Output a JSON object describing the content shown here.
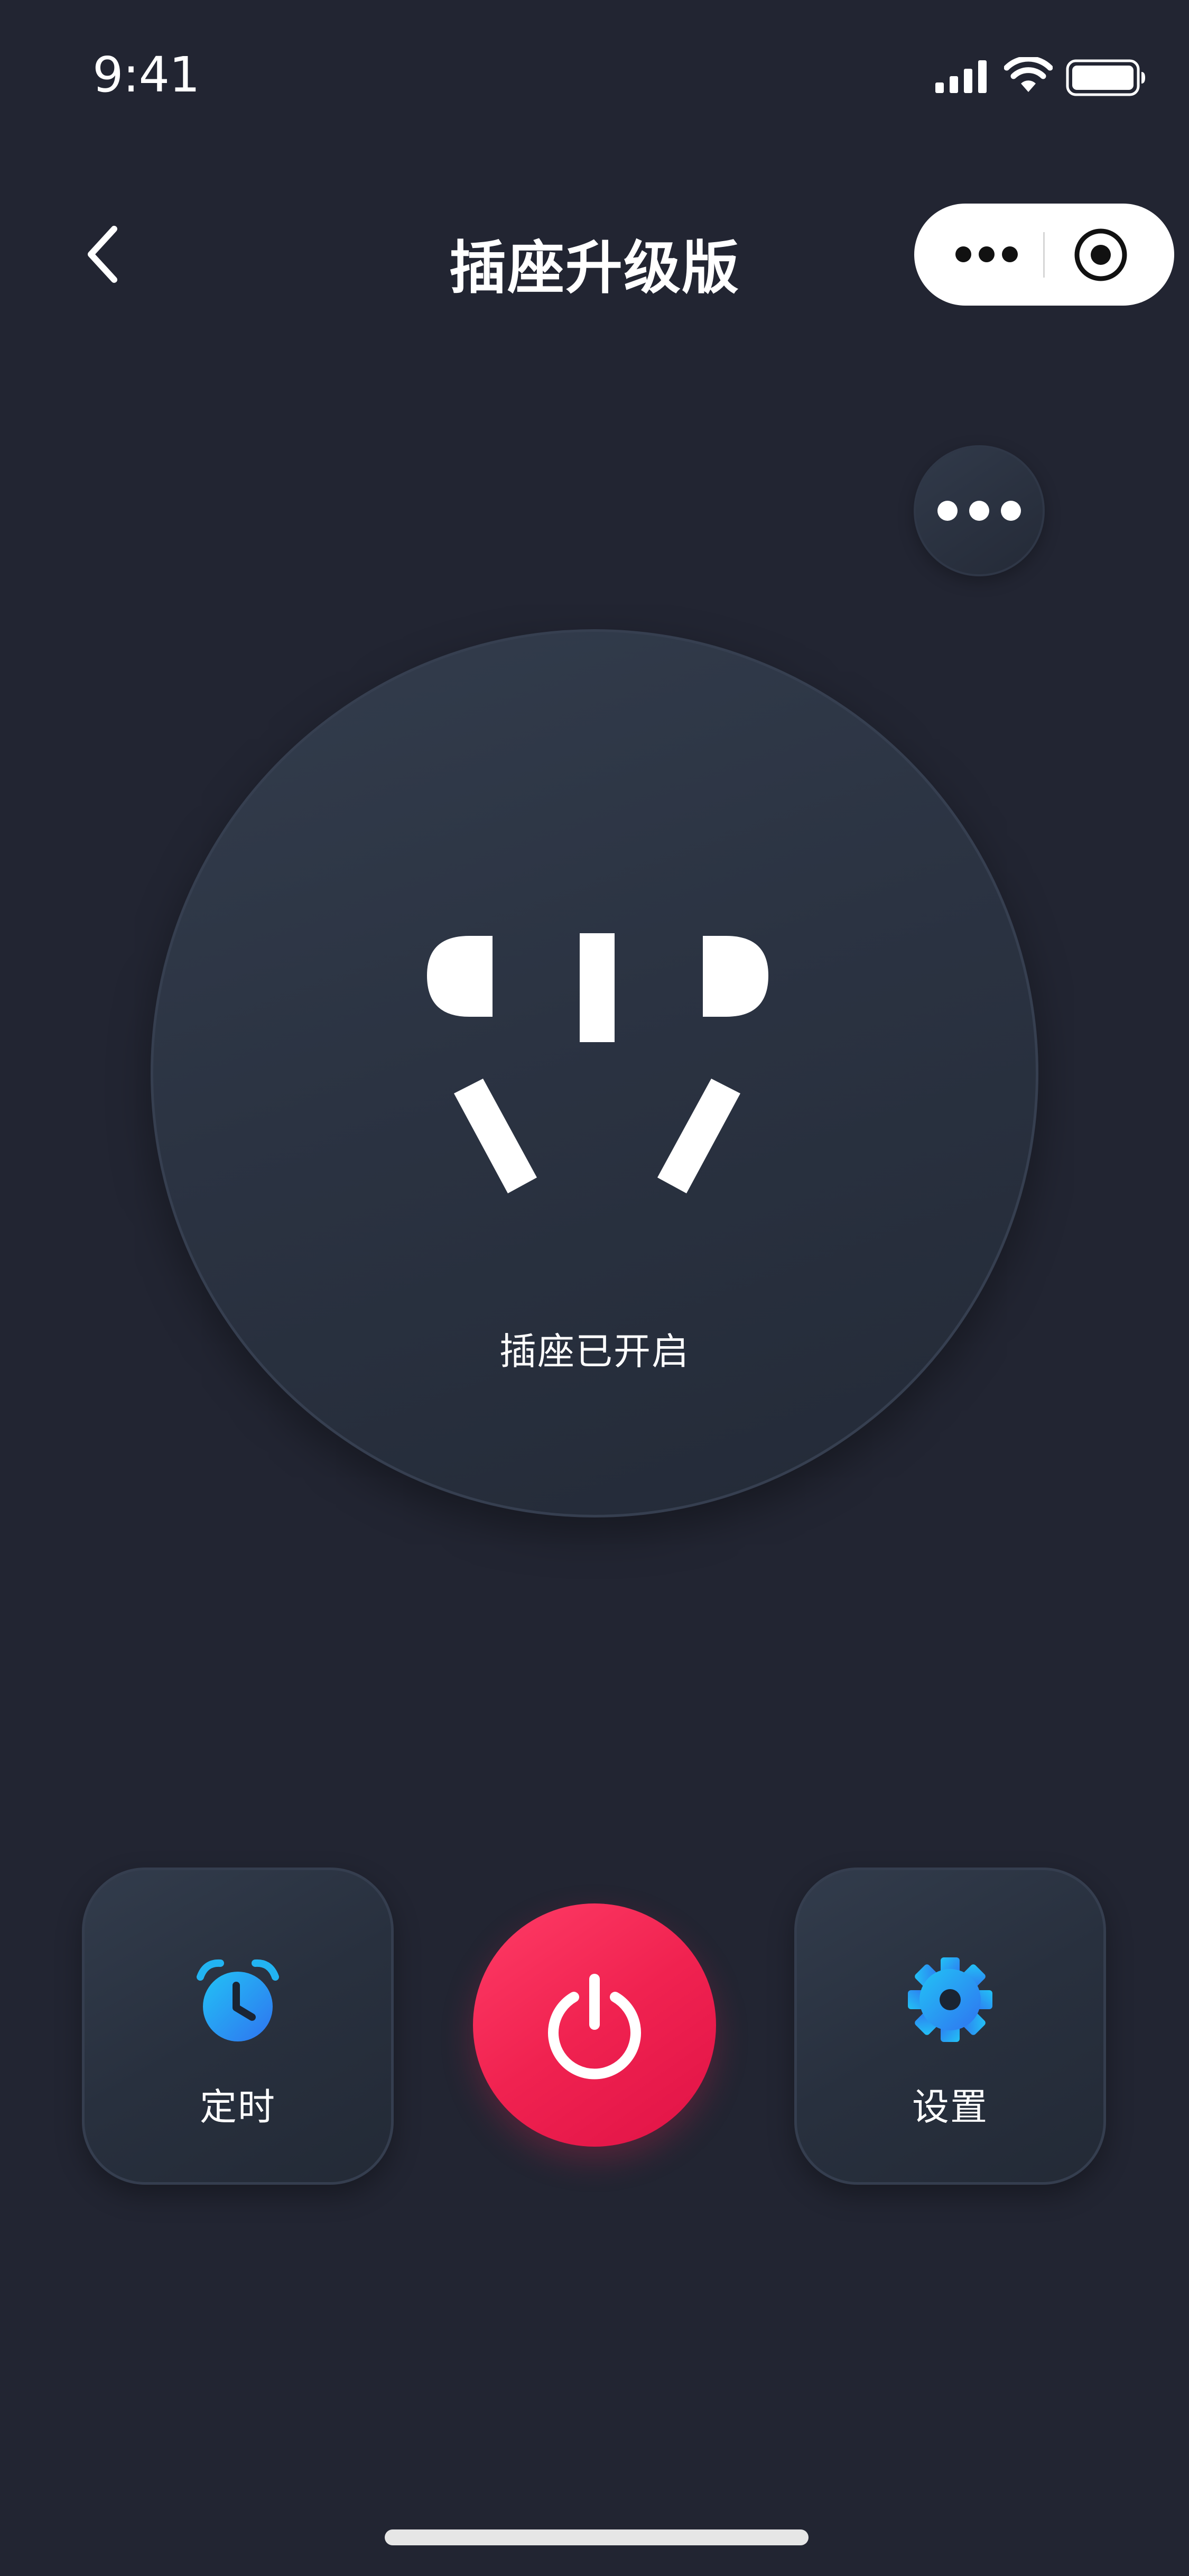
{
  "status_bar": {
    "time": "9:41"
  },
  "nav": {
    "title": "插座升级版"
  },
  "socket": {
    "status_text": "插座已开启",
    "state": "on"
  },
  "controls": {
    "timer_label": "定时",
    "settings_label": "设置"
  },
  "colors": {
    "background": "#222532",
    "power_button": "#f02250",
    "icon_accent": "#1fa6ef"
  },
  "icons": [
    "signal-icon",
    "wifi-icon",
    "battery-icon",
    "back-icon",
    "more-icon",
    "close-circle-icon",
    "socket-icon",
    "alarm-clock-icon",
    "power-icon",
    "gear-icon"
  ]
}
